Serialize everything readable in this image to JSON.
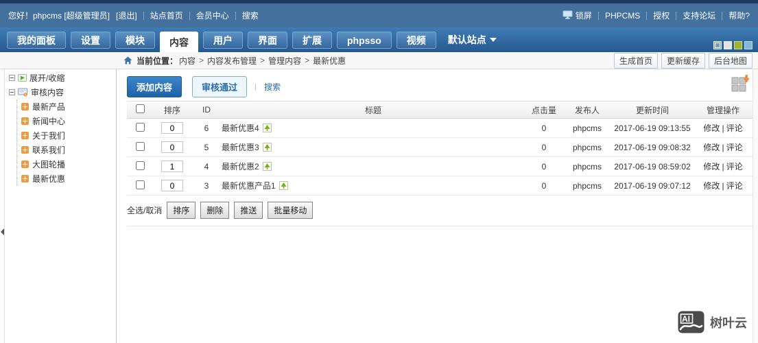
{
  "colors": {
    "topstrip": "#1c3b5e",
    "topbar": "#44709d",
    "navtop": "#3e7cb4",
    "navbottom": "#27598e",
    "tabtop": "#5d92c3",
    "tabbottom": "#34679f",
    "tabborder": "#7aa6d1",
    "accent": "#2a6cac",
    "addtop": "#3a86c8",
    "addbottom": "#1f63a8",
    "orange": "#ef9a3d",
    "theme0": "#6d9cc6",
    "theme1": "#e3e3e3",
    "theme2": "#9cb52b",
    "theme3": "#85b7dd"
  },
  "topbar": {
    "greeting": "您好！phpcms [超级管理员]",
    "logout": "[退出]",
    "site_home": "站点首页",
    "member_center": "会员中心",
    "search": "搜索",
    "lock_screen": "锁屏",
    "phpcms": "PHPCMS",
    "license": "授权",
    "support_forum": "支持论坛",
    "help": "帮助?"
  },
  "nav": {
    "tabs": [
      {
        "label": "我的面板"
      },
      {
        "label": "设置"
      },
      {
        "label": "模块"
      },
      {
        "label": "内容",
        "active": true
      },
      {
        "label": "用户"
      },
      {
        "label": "界面"
      },
      {
        "label": "扩展"
      },
      {
        "label": "phpsso"
      },
      {
        "label": "视频"
      }
    ],
    "site_selector": "默认站点"
  },
  "breadcrumb": {
    "prefix": "当前位置：",
    "sep": ">",
    "items": [
      "内容",
      "内容发布管理",
      "管理内容",
      "最新优惠"
    ],
    "actions": [
      "生成首页",
      "更新缓存",
      "后台地图"
    ]
  },
  "sidebar": {
    "toggle": "展开/收缩",
    "root": "审核内容",
    "items": [
      "最新产品",
      "新闻中心",
      "关于我们",
      "联系我们",
      "大图轮播",
      "最新优惠"
    ]
  },
  "toolbar": {
    "add": "添加内容",
    "approve": "审核通过",
    "sep": "|",
    "search": "搜索"
  },
  "table": {
    "headers": [
      "排序",
      "ID",
      "标题",
      "点击量",
      "发布人",
      "更新时间",
      "管理操作"
    ],
    "op_sep": "|",
    "rows": [
      {
        "sort": "0",
        "id": "6",
        "title": "最新优惠4",
        "clicks": "0",
        "author": "phpcms",
        "time": "2017-06-19 09:13:55",
        "edit": "修改",
        "comment": "评论"
      },
      {
        "sort": "0",
        "id": "5",
        "title": "最新优惠3",
        "clicks": "0",
        "author": "phpcms",
        "time": "2017-06-19 09:08:32",
        "edit": "修改",
        "comment": "评论"
      },
      {
        "sort": "1",
        "id": "4",
        "title": "最新优惠2",
        "clicks": "0",
        "author": "phpcms",
        "time": "2017-06-19 08:59:02",
        "edit": "修改",
        "comment": "评论"
      },
      {
        "sort": "0",
        "id": "3",
        "title": "最新优惠产品1",
        "clicks": "0",
        "author": "phpcms",
        "time": "2017-06-19 09:07:12",
        "edit": "修改",
        "comment": "评论"
      }
    ]
  },
  "batch": {
    "select_all": "全选/取消",
    "buttons": [
      "排序",
      "删除",
      "推送",
      "批量移动"
    ]
  },
  "watermark": {
    "logo": "AI",
    "brand": "树叶云"
  }
}
